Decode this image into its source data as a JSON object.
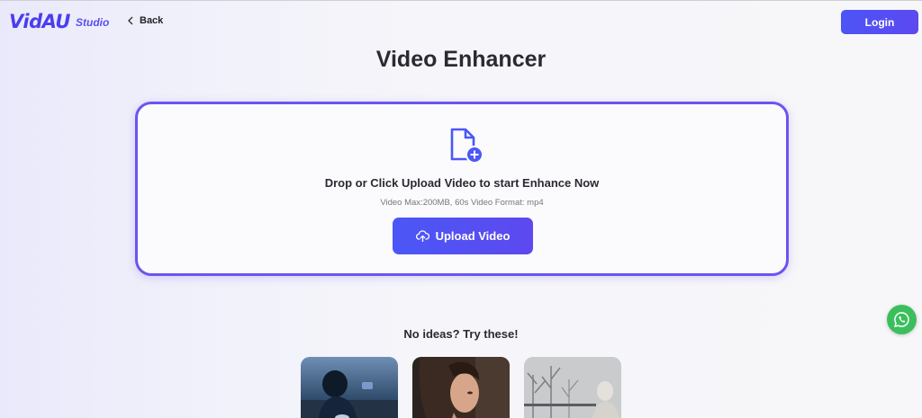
{
  "header": {
    "logo_text": "VidAU",
    "studio_label": "Studio",
    "back_label": "Back",
    "login_label": "Login"
  },
  "page": {
    "title": "Video Enhancer"
  },
  "upload": {
    "icon": "file-add-icon",
    "drop_text": "Drop or Click Upload Video to start Enhance Now",
    "limits_text": "Video Max:200MB, 60s Video Format: mp4",
    "button_label": "Upload Video",
    "button_icon": "cloud-upload-icon"
  },
  "ideas": {
    "title": "No ideas? Try these!",
    "samples": [
      {
        "name": "sample-video-motorcyclist"
      },
      {
        "name": "sample-video-woman-portrait"
      },
      {
        "name": "sample-video-old-man-trees"
      }
    ]
  },
  "floating": {
    "whatsapp_icon": "whatsapp-icon"
  },
  "colors": {
    "accent": "#5b4ff0",
    "whatsapp": "#3bbf5c"
  }
}
